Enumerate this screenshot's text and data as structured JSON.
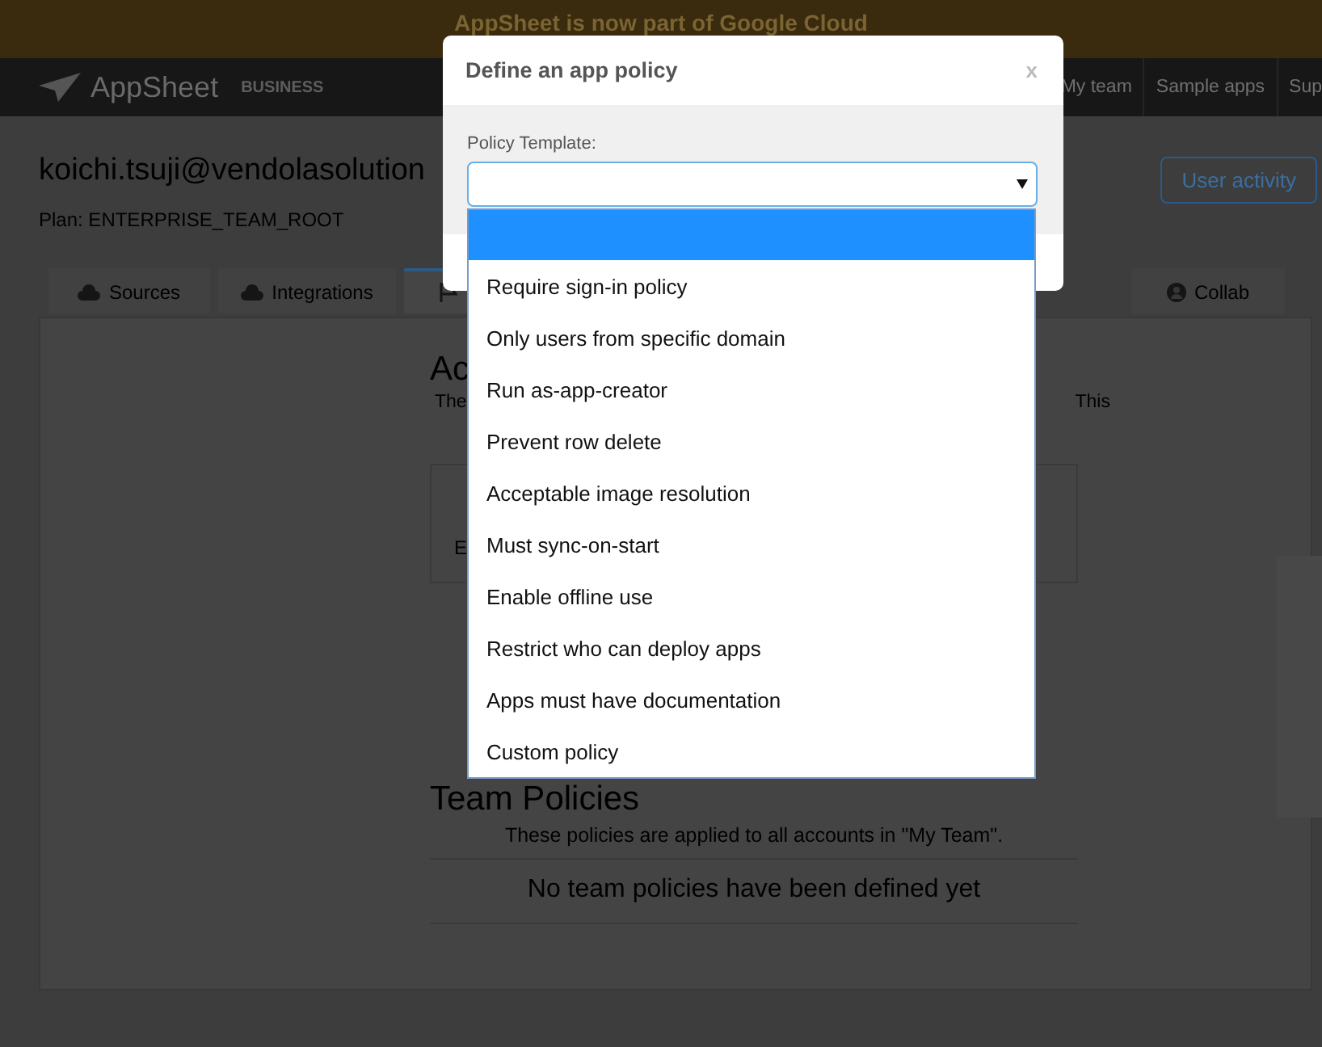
{
  "banner": {
    "text": "AppSheet is now part of Google Cloud"
  },
  "nav": {
    "brand": "AppSheet",
    "edition": "BUSINESS",
    "links": [
      "My team",
      "Sample apps",
      "Sup"
    ]
  },
  "account": {
    "email": "koichi.tsuji@vendolasolution",
    "plan": "Plan: ENTERPRISE_TEAM_ROOT",
    "user_activity": "User activity"
  },
  "tabs": [
    {
      "label": "Sources",
      "selected": false
    },
    {
      "label": "Integrations",
      "selected": false
    },
    {
      "selected": true
    },
    {
      "label": "Collab",
      "selected": false
    }
  ],
  "account_policies": {
    "heading": "Ac",
    "text_start": "The",
    "text_end": "This",
    "card_text": "E"
  },
  "team_policies": {
    "heading": "Team Policies",
    "description": "These policies are applied to all accounts in \"My Team\".",
    "empty_message": "No team policies have been defined yet"
  },
  "modal": {
    "title": "Define an app policy",
    "close": "x",
    "field_label": "Policy Template:",
    "blank_option_highlighted": true,
    "options": [
      {
        "label": "Require sign-in policy",
        "selected": false
      },
      {
        "label": "Only users from specific domain",
        "selected": false
      },
      {
        "label": "Run as-app-creator",
        "selected": false
      },
      {
        "label": "Prevent row delete",
        "selected": false
      },
      {
        "label": "Acceptable image resolution",
        "selected": false
      },
      {
        "label": "Must sync-on-start",
        "selected": false
      },
      {
        "label": "Enable offline use",
        "selected": false
      },
      {
        "label": "Restrict who can deploy apps",
        "selected": false
      },
      {
        "label": "Apps must have documentation",
        "selected": false
      },
      {
        "label": "Custom policy",
        "selected": false
      }
    ]
  }
}
